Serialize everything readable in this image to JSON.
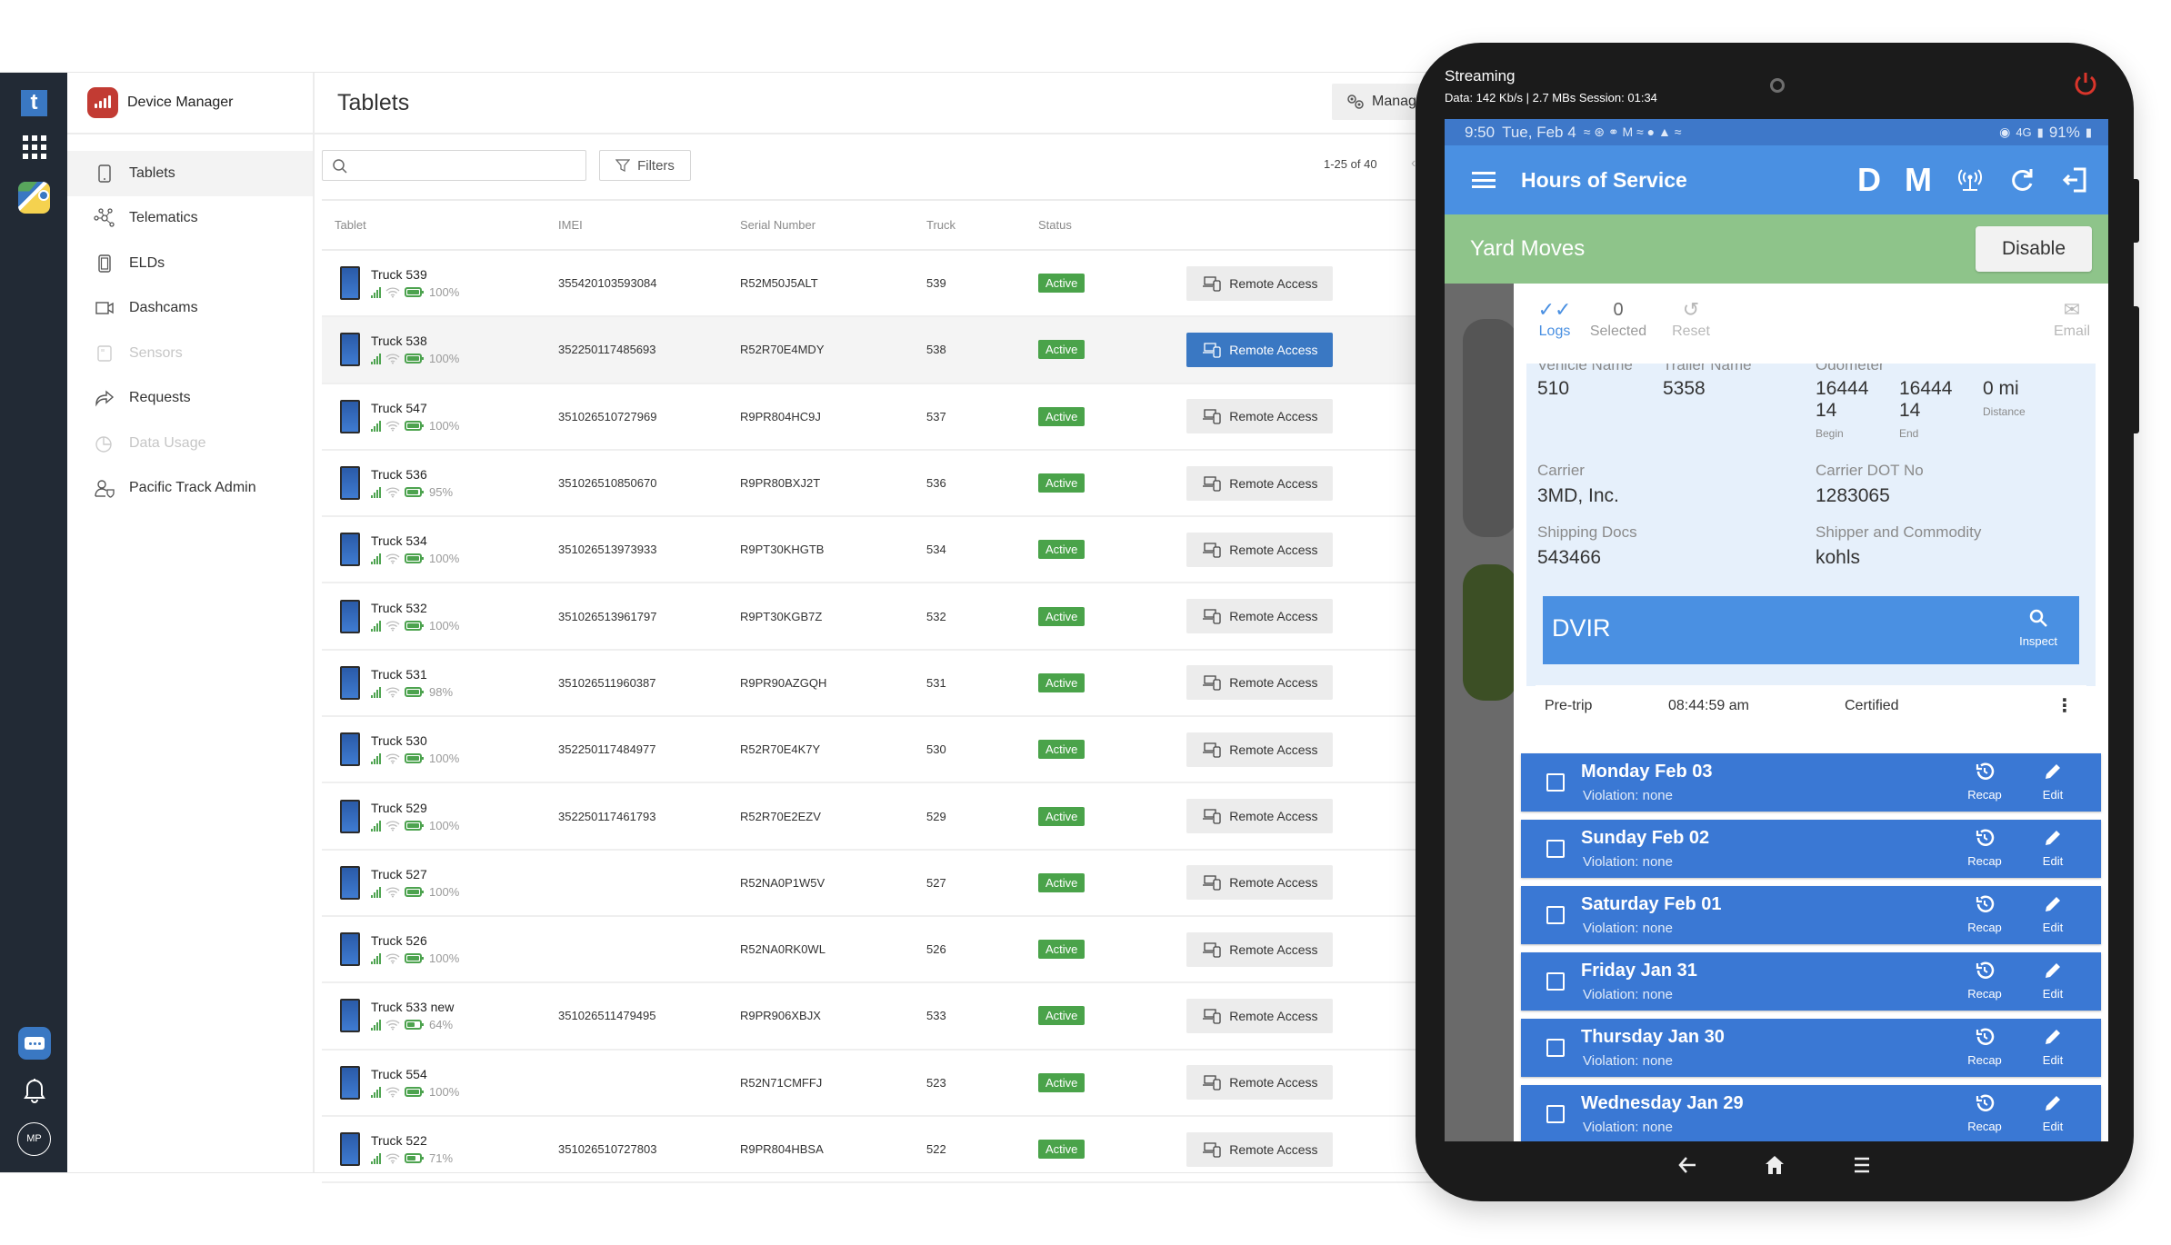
{
  "rail": {
    "logo_letter": "t",
    "avatar_initials": "MP"
  },
  "nav": {
    "app_title": "Device Manager",
    "items": [
      {
        "label": "Tablets",
        "icon": "tablet-icon",
        "state": "active"
      },
      {
        "label": "Telematics",
        "icon": "network-icon",
        "state": "normal"
      },
      {
        "label": "ELDs",
        "icon": "eld-chip-icon",
        "state": "normal"
      },
      {
        "label": "Dashcams",
        "icon": "video-camera-icon",
        "state": "normal"
      },
      {
        "label": "Sensors",
        "icon": "sensor-icon",
        "state": "disabled"
      },
      {
        "label": "Requests",
        "icon": "share-arrow-icon",
        "state": "normal"
      },
      {
        "label": "Data Usage",
        "icon": "pie-chart-icon",
        "state": "disabled"
      },
      {
        "label": "Pacific Track Admin",
        "icon": "admin-user-shield-icon",
        "state": "normal"
      }
    ]
  },
  "main": {
    "page_title": "Tablets",
    "manage_label": "Manag",
    "search": {
      "value": "",
      "placeholder": ""
    },
    "filters_label": "Filters",
    "pagination": "1-25 of 40",
    "columns": [
      "Tablet",
      "IMEI",
      "Serial Number",
      "Truck",
      "Status"
    ],
    "remote_label": "Remote Access",
    "rows": [
      {
        "name": "Truck 539",
        "battery": "100%",
        "battery_level": 1.0,
        "imei": "355420103593084",
        "serial": "R52M50J5ALT",
        "truck": "539",
        "status": "Active",
        "highlight": false
      },
      {
        "name": "Truck 538",
        "battery": "100%",
        "battery_level": 1.0,
        "imei": "352250117485693",
        "serial": "R52R70E4MDY",
        "truck": "538",
        "status": "Active",
        "highlight": true
      },
      {
        "name": "Truck 547",
        "battery": "100%",
        "battery_level": 1.0,
        "imei": "351026510727969",
        "serial": "R9PR804HC9J",
        "truck": "537",
        "status": "Active",
        "highlight": false
      },
      {
        "name": "Truck 536",
        "battery": "95%",
        "battery_level": 0.95,
        "imei": "351026510850670",
        "serial": "R9PR80BXJ2T",
        "truck": "536",
        "status": "Active",
        "highlight": false
      },
      {
        "name": "Truck 534",
        "battery": "100%",
        "battery_level": 1.0,
        "imei": "351026513973933",
        "serial": "R9PT30KHGTB",
        "truck": "534",
        "status": "Active",
        "highlight": false
      },
      {
        "name": "Truck 532",
        "battery": "100%",
        "battery_level": 1.0,
        "imei": "351026513961797",
        "serial": "R9PT30KGB7Z",
        "truck": "532",
        "status": "Active",
        "highlight": false
      },
      {
        "name": "Truck 531",
        "battery": "98%",
        "battery_level": 0.98,
        "imei": "351026511960387",
        "serial": "R9PR90AZGQH",
        "truck": "531",
        "status": "Active",
        "highlight": false
      },
      {
        "name": "Truck 530",
        "battery": "100%",
        "battery_level": 1.0,
        "imei": "352250117484977",
        "serial": "R52R70E4K7Y",
        "truck": "530",
        "status": "Active",
        "highlight": false
      },
      {
        "name": "Truck 529",
        "battery": "100%",
        "battery_level": 1.0,
        "imei": "352250117461793",
        "serial": "R52R70E2EZV",
        "truck": "529",
        "status": "Active",
        "highlight": false
      },
      {
        "name": "Truck 527",
        "battery": "100%",
        "battery_level": 1.0,
        "imei": "",
        "serial": "R52NA0P1W5V",
        "truck": "527",
        "status": "Active",
        "highlight": false
      },
      {
        "name": "Truck 526",
        "battery": "100%",
        "battery_level": 1.0,
        "imei": "",
        "serial": "R52NA0RK0WL",
        "truck": "526",
        "status": "Active",
        "highlight": false
      },
      {
        "name": "Truck 533 new",
        "battery": "64%",
        "battery_level": 0.64,
        "imei": "351026511479495",
        "serial": "R9PR906XBJX",
        "truck": "533",
        "status": "Active",
        "highlight": false
      },
      {
        "name": "Truck 554",
        "battery": "100%",
        "battery_level": 1.0,
        "imei": "",
        "serial": "R52N71CMFFJ",
        "truck": "523",
        "status": "Active",
        "highlight": false
      },
      {
        "name": "Truck 522",
        "battery": "71%",
        "battery_level": 0.71,
        "imei": "351026510727803",
        "serial": "R9PR804HBSA",
        "truck": "522",
        "status": "Active",
        "highlight": false
      }
    ]
  },
  "phone": {
    "stream_title": "Streaming",
    "stream_stats": "Data: 142 Kb/s | 2.7 MBs  Session: 01:34",
    "statusbar": {
      "time": "9:50",
      "date": "Tue, Feb 4",
      "network": "4G",
      "battery": "91%"
    },
    "appbar": {
      "title": "Hours of Service",
      "letter_d": "D",
      "letter_m": "M"
    },
    "yard_moves": {
      "label": "Yard Moves",
      "button": "Disable"
    },
    "log_tabs": {
      "logs": "Logs",
      "selected_count": "0",
      "selected": "Selected",
      "reset": "Reset",
      "email": "Email"
    },
    "info": {
      "vehicle_label": "Vehicle Name",
      "vehicle": "510",
      "trailer_label": "Trailer Name",
      "trailer": "5358",
      "odometer_label": "Odometer",
      "odo_begin": "16444\n14",
      "odo_begin_label": "Begin",
      "odo_end": "16444\n14",
      "odo_end_label": "End",
      "distance": "0 mi",
      "distance_label": "Distance",
      "carrier_label": "Carrier",
      "carrier": "3MD, Inc.",
      "dot_label": "Carrier DOT No",
      "dot": "1283065",
      "shipping_label": "Shipping Docs",
      "shipping": "543466",
      "shipper_label": "Shipper and Commodity",
      "shipper": "kohls"
    },
    "dvir": {
      "title": "DVIR",
      "inspect": "Inspect",
      "type": "Pre-trip",
      "time": "08:44:59 am",
      "status": "Certified"
    },
    "days": [
      {
        "title": "Monday Feb 03",
        "violation": "Violation: none"
      },
      {
        "title": "Sunday Feb 02",
        "violation": "Violation: none"
      },
      {
        "title": "Saturday Feb 01",
        "violation": "Violation: none"
      },
      {
        "title": "Friday Jan 31",
        "violation": "Violation: none"
      },
      {
        "title": "Thursday Jan 30",
        "violation": "Violation: none"
      },
      {
        "title": "Wednesday Jan 29",
        "violation": "Violation: none"
      }
    ],
    "day_actions": {
      "recap": "Recap",
      "edit": "Edit"
    }
  }
}
